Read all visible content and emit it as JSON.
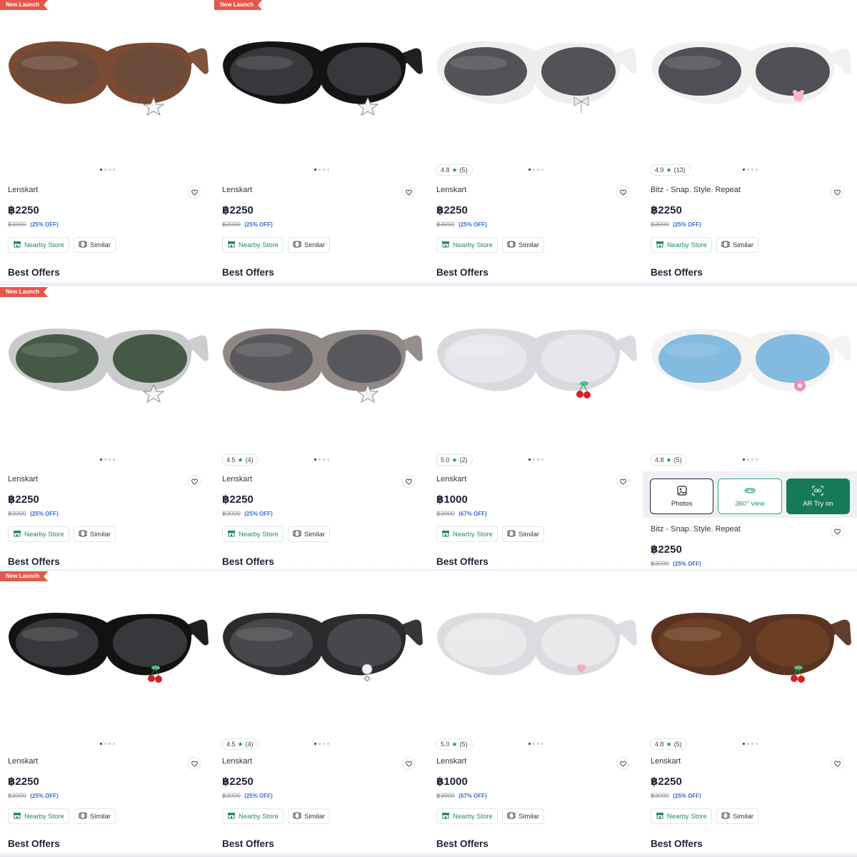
{
  "badge_text": "New Launch",
  "labels": {
    "nearby_store": "Nearby Store",
    "similar": "Similar",
    "best_offers": "Best Offers"
  },
  "tryon": {
    "photos": "Photos",
    "view360": "360° view",
    "ar": "AR Try on"
  },
  "products": [
    {
      "brand": "Lenskart",
      "price": "฿2250",
      "was": "฿3000",
      "off": "(25% OFF)",
      "rating": null,
      "reviews": null,
      "badge": true,
      "frame_color": "#7a4a33",
      "lens_color": "#6b4a3a",
      "icon": "star-charm-icon"
    },
    {
      "brand": "Lenskart",
      "price": "฿2250",
      "was": "฿3000",
      "off": "(25% OFF)",
      "rating": null,
      "reviews": null,
      "badge": true,
      "frame_color": "#141414",
      "lens_color": "#3a3a3e",
      "icon": "star-charm-icon"
    },
    {
      "brand": "Lenskart",
      "price": "฿2250",
      "was": "฿3000",
      "off": "(25% OFF)",
      "rating": "4.8",
      "reviews": "(5)",
      "badge": false,
      "frame_color": "#eeeeee",
      "lens_color": "#4a4a4e",
      "icon": "bow-charm-icon"
    },
    {
      "brand": "Bitz - Snap. Style. Repeat",
      "price": "฿2250",
      "was": "฿3000",
      "off": "(25% OFF)",
      "rating": "4.9",
      "reviews": "(13)",
      "badge": false,
      "frame_color": "#f2f0ee",
      "lens_color": "#45474d",
      "icon": "bear-charm-icon"
    },
    {
      "brand": "Lenskart",
      "price": "฿2250",
      "was": "฿3000",
      "off": "(25% OFF)",
      "rating": null,
      "reviews": null,
      "badge": true,
      "frame_color": "#c9cacc",
      "lens_color": "#3f523f",
      "icon": "star-charm-icon"
    },
    {
      "brand": "Lenskart",
      "price": "฿2250",
      "was": "฿3000",
      "off": "(25% OFF)",
      "rating": "4.5",
      "reviews": "(4)",
      "badge": false,
      "frame_color": "#8f8884",
      "lens_color": "#55555a",
      "icon": "star-charm-icon"
    },
    {
      "brand": "Lenskart",
      "price": "฿1000",
      "was": "฿3000",
      "off": "(67% OFF)",
      "rating": "5.0",
      "reviews": "(2)",
      "badge": false,
      "frame_color": "#d9d9de",
      "lens_color": "#f5f5f7",
      "icon": "cherry-charm-icon"
    },
    {
      "brand": "Bitz - Snap. Style. Repeat",
      "price": "฿2250",
      "was": "฿3000",
      "off": "(25% OFF)",
      "rating": "4.8",
      "reviews": "(5)",
      "badge": false,
      "frame_color": "#f4f3f1",
      "lens_color": "#7cb6de",
      "icon": "donut-charm-icon"
    },
    {
      "brand": "Lenskart",
      "price": "฿2250",
      "was": "฿3000",
      "off": "(25% OFF)",
      "rating": null,
      "reviews": null,
      "badge": true,
      "frame_color": "#121212",
      "lens_color": "#3b3b3f",
      "icon": "cherry-charm-icon"
    },
    {
      "brand": "Lenskart",
      "price": "฿2250",
      "was": "฿3000",
      "off": "(25% OFF)",
      "rating": "4.5",
      "reviews": "(4)",
      "badge": false,
      "frame_color": "#2b2b2d",
      "lens_color": "#4a4a4e",
      "icon": "pearl-charm-icon"
    },
    {
      "brand": "Lenskart",
      "price": "฿1000",
      "was": "฿3000",
      "off": "(67% OFF)",
      "rating": "5.0",
      "reviews": "(5)",
      "badge": false,
      "frame_color": "#dcdce0",
      "lens_color": "#f6f6f8",
      "icon": "heart-charm-icon"
    },
    {
      "brand": "Lenskart",
      "price": "฿2250",
      "was": "฿3000",
      "off": "(25% OFF)",
      "rating": "4.8",
      "reviews": "(5)",
      "badge": false,
      "frame_color": "#5a3322",
      "lens_color": "#6e3f24",
      "icon": "cherry-charm-icon"
    }
  ]
}
